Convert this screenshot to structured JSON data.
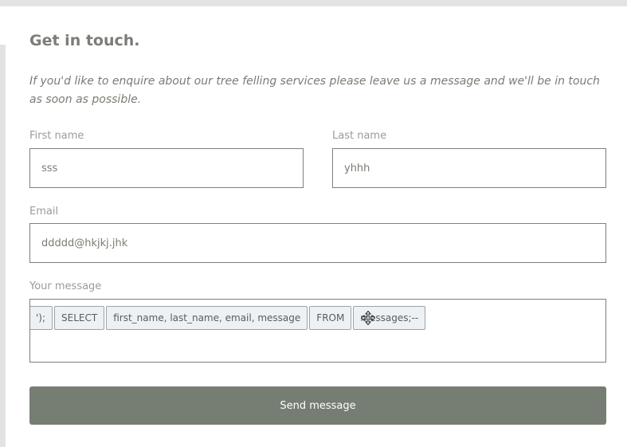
{
  "form": {
    "heading": "Get in touch.",
    "intro": "If you'd like to enquire about our tree felling services please leave us a message and we'll be in touch as soon as possible.",
    "first_name": {
      "label": "First name",
      "value": "sss"
    },
    "last_name": {
      "label": "Last name",
      "value": "yhhh"
    },
    "email": {
      "label": "Email",
      "value": "ddddd@hkjkj.jhk"
    },
    "message": {
      "label": "Your message",
      "tokens": [
        "');",
        "SELECT",
        "first_name, last_name, email, message",
        "FROM",
        "messages;--"
      ]
    },
    "submit_label": "Send message"
  },
  "colors": {
    "button_bg": "#767e74",
    "heading": "#7a7e76",
    "token_bg": "#eef1f4"
  },
  "icons": {
    "cursor": "move-cursor-icon"
  }
}
